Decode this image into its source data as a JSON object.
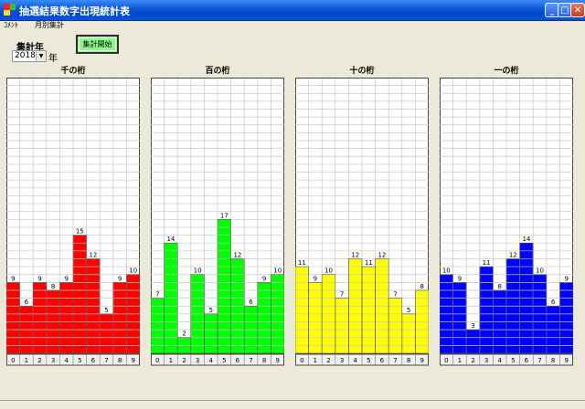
{
  "window": {
    "title": "抽選結果数字出現統計表",
    "icon": "app-grid-icon",
    "buttons": [
      "minimize-icon",
      "maximize-icon",
      "close-icon"
    ]
  },
  "menu": {
    "items": [
      "ｺﾒﾝﾄ",
      "月別集計"
    ]
  },
  "controls": {
    "year_label": "集計年",
    "year_value": "2018",
    "year_suffix": "年",
    "start_button": "集計開始"
  },
  "chart_data": [
    {
      "type": "bar",
      "title": "千の桁",
      "categories": [
        "0",
        "1",
        "2",
        "3",
        "4",
        "5",
        "6",
        "7",
        "8",
        "9"
      ],
      "values": [
        9,
        6,
        9,
        8,
        9,
        15,
        12,
        5,
        9,
        10
      ],
      "color": "#ff0000",
      "ylim": [
        0,
        35
      ],
      "grid": true
    },
    {
      "type": "bar",
      "title": "百の桁",
      "categories": [
        "0",
        "1",
        "2",
        "3",
        "4",
        "5",
        "6",
        "7",
        "8",
        "9"
      ],
      "values": [
        7,
        14,
        2,
        10,
        5,
        17,
        12,
        6,
        9,
        10
      ],
      "color": "#00ff00",
      "ylim": [
        0,
        35
      ],
      "grid": true
    },
    {
      "type": "bar",
      "title": "十の桁",
      "categories": [
        "0",
        "1",
        "2",
        "3",
        "4",
        "5",
        "6",
        "7",
        "8",
        "9"
      ],
      "values": [
        11,
        9,
        10,
        7,
        12,
        11,
        12,
        7,
        5,
        8
      ],
      "color": "#ffff00",
      "ylim": [
        0,
        35
      ],
      "grid": true
    },
    {
      "type": "bar",
      "title": "一の桁",
      "categories": [
        "0",
        "1",
        "2",
        "3",
        "4",
        "5",
        "6",
        "7",
        "8",
        "9"
      ],
      "values": [
        10,
        9,
        3,
        11,
        8,
        12,
        14,
        10,
        6,
        9
      ],
      "color": "#0000ff",
      "ylim": [
        0,
        35
      ],
      "grid": true
    }
  ]
}
